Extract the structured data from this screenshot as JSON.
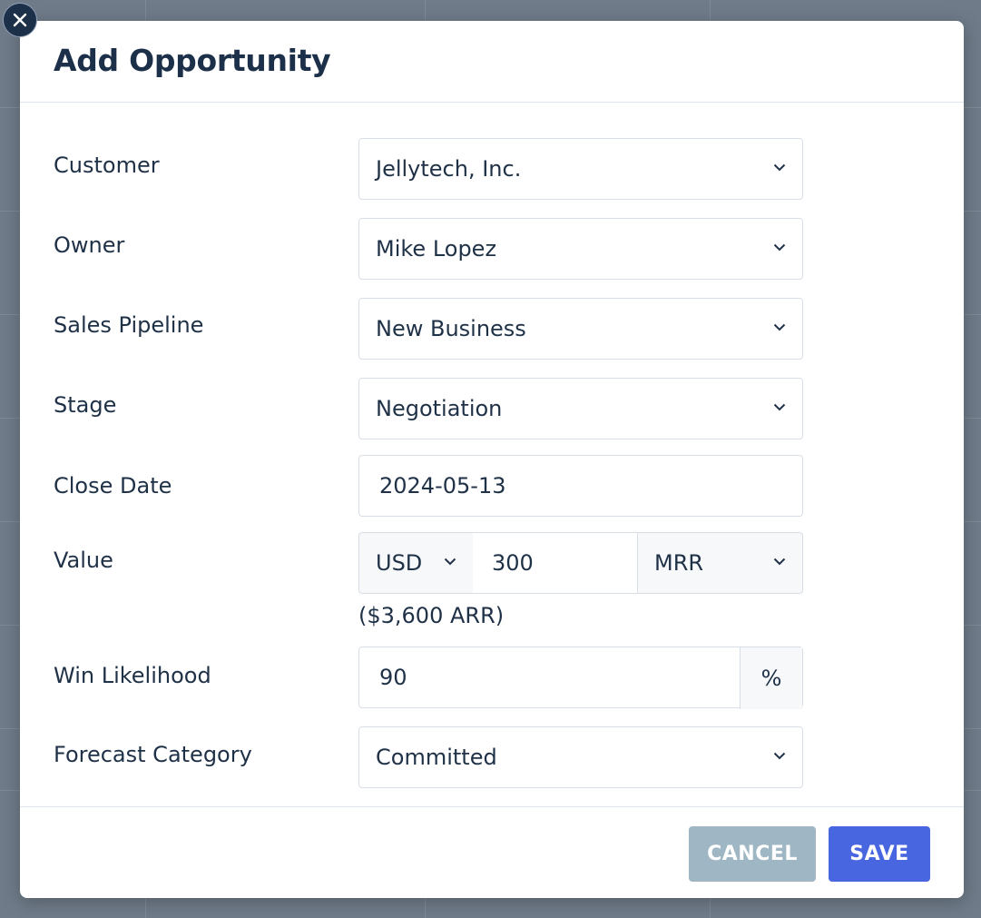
{
  "modal": {
    "title": "Add Opportunity"
  },
  "form": {
    "customer": {
      "label": "Customer",
      "value": "Jellytech, Inc."
    },
    "owner": {
      "label": "Owner",
      "value": "Mike Lopez"
    },
    "pipeline": {
      "label": "Sales Pipeline",
      "value": "New Business"
    },
    "stage": {
      "label": "Stage",
      "value": "Negotiation"
    },
    "close_date": {
      "label": "Close Date",
      "value": "2024-05-13"
    },
    "value": {
      "label": "Value",
      "currency": "USD",
      "amount": "300",
      "period": "MRR",
      "note": "($3,600 ARR)"
    },
    "win_likelihood": {
      "label": "Win Likelihood",
      "value": "90",
      "suffix": "%"
    },
    "forecast_category": {
      "label": "Forecast Category",
      "value": "Committed"
    }
  },
  "footer": {
    "cancel_label": "CANCEL",
    "save_label": "SAVE"
  },
  "colors": {
    "primary": "#4866e0",
    "cancel": "#9fb7c4",
    "title": "#1c3049"
  },
  "icons": {
    "close": "close-icon",
    "dropdown": "chevron-down-icon"
  }
}
